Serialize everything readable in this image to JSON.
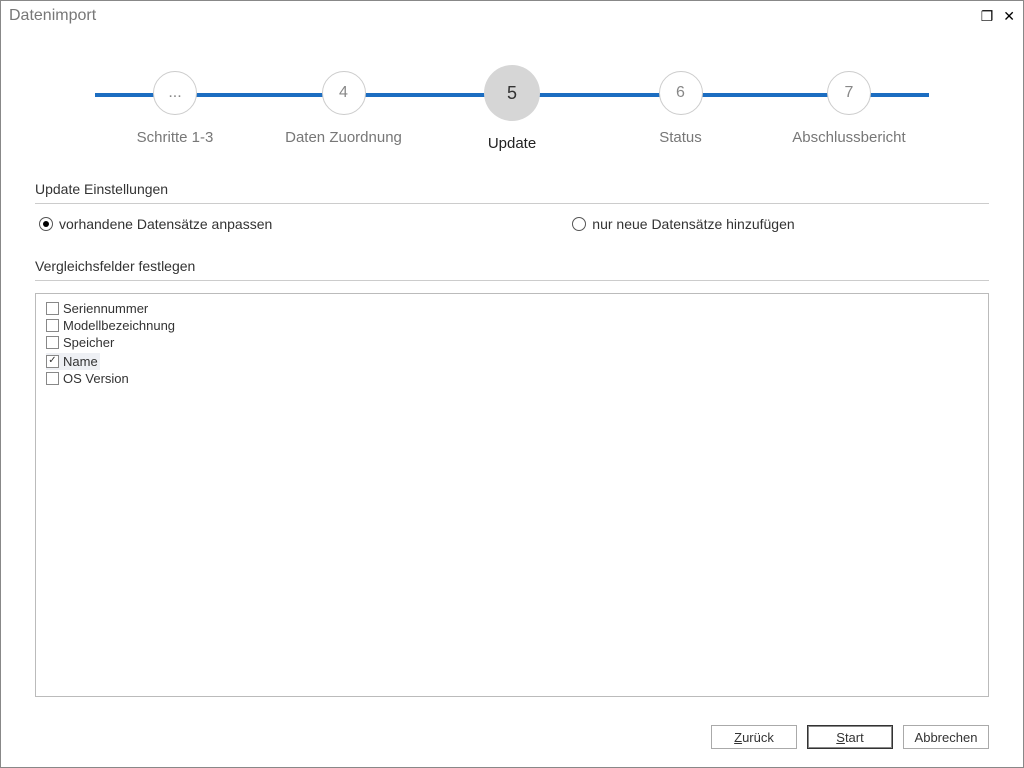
{
  "window": {
    "title": "Datenimport"
  },
  "stepper": {
    "steps": [
      {
        "num": "...",
        "label": "Schritte 1-3",
        "active": false
      },
      {
        "num": "4",
        "label": "Daten Zuordnung",
        "active": false
      },
      {
        "num": "5",
        "label": "Update",
        "active": true
      },
      {
        "num": "6",
        "label": "Status",
        "active": false
      },
      {
        "num": "7",
        "label": "Abschlussbericht",
        "active": false
      }
    ]
  },
  "updateSettings": {
    "title": "Update Einstellungen",
    "options": {
      "adjust": "vorhandene Datensätze anpassen",
      "addNew": "nur neue Datensätze hinzufügen"
    }
  },
  "compareFields": {
    "title": "Vergleichsfelder festlegen",
    "items": [
      {
        "label": "Seriennummer",
        "checked": false,
        "selected": false
      },
      {
        "label": "Modellbezeichnung",
        "checked": false,
        "selected": false
      },
      {
        "label": "Speicher",
        "checked": false,
        "selected": false
      },
      {
        "label": "Name",
        "checked": true,
        "selected": true
      },
      {
        "label": "OS Version",
        "checked": false,
        "selected": false
      }
    ]
  },
  "buttons": {
    "back": "Zurück",
    "start": "Start",
    "cancel": "Abbrechen"
  }
}
